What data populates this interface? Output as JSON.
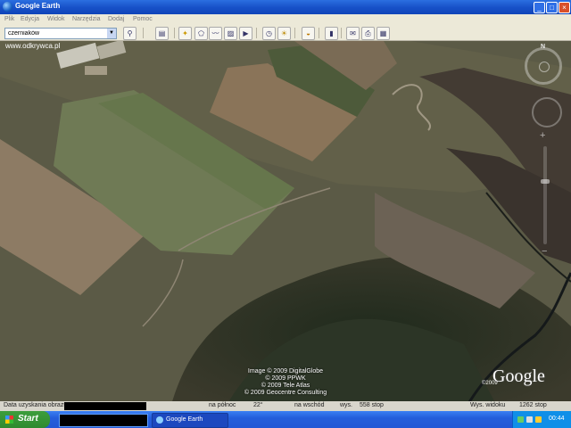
{
  "window": {
    "title": "Google Earth",
    "controls": [
      "_",
      "□",
      "×"
    ]
  },
  "menu": [
    "Plik",
    "Edycja",
    "Widok",
    "Narzędzia",
    "Dodaj",
    "Pomoc"
  ],
  "search": {
    "value": "czerniaków",
    "button_icon": "search-icon"
  },
  "toolbar": {
    "icons": [
      "sidebar-icon",
      "placemark-icon",
      "polygon-icon",
      "path-icon",
      "image-overlay-icon",
      "tour-icon",
      "historical-imagery-icon",
      "sunlight-icon",
      "sky-icon",
      "ruler-icon",
      "email-icon",
      "print-icon",
      "maps-icon"
    ]
  },
  "map": {
    "watermark": "www.odkrywca.pl",
    "credits": [
      "Image © 2009 DigitalGlobe",
      "© 2009 PPWK",
      "© 2009 Tele Atlas",
      "© 2009 Geocentre Consulting"
    ],
    "logo": "Google",
    "logo_year": "©2009",
    "nav": {
      "north": "N"
    }
  },
  "status": {
    "date_label": "Data uzyskania obrazu",
    "lat": "na północ",
    "lat_val": "22°",
    "lon": "na wschód",
    "elev_label": "wys.",
    "elev_val": "558 stop",
    "view_label": "Wys. widoku",
    "view_val": "1262 stop"
  },
  "taskbar": {
    "start": "Start",
    "task_google_earth": "Google Earth",
    "clock": "00:44"
  }
}
